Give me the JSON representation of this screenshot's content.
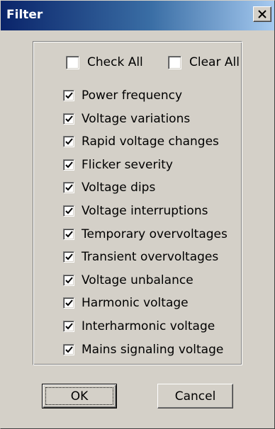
{
  "window": {
    "title": "Filter",
    "close_glyph": "close-x-icon"
  },
  "check_all": {
    "label": "Check All",
    "checked": false
  },
  "clear_all": {
    "label": "Clear All",
    "checked": false
  },
  "items": [
    {
      "label": "Power frequency",
      "checked": true
    },
    {
      "label": "Voltage variations",
      "checked": true
    },
    {
      "label": "Rapid voltage changes",
      "checked": true
    },
    {
      "label": "Flicker severity",
      "checked": true
    },
    {
      "label": "Voltage dips",
      "checked": true
    },
    {
      "label": "Voltage interruptions",
      "checked": true
    },
    {
      "label": "Temporary overvoltages",
      "checked": true
    },
    {
      "label": "Transient overvoltages",
      "checked": true
    },
    {
      "label": "Voltage unbalance",
      "checked": true
    },
    {
      "label": "Harmonic voltage",
      "checked": true
    },
    {
      "label": "Interharmonic voltage",
      "checked": true
    },
    {
      "label": "Mains signaling voltage",
      "checked": true
    }
  ],
  "buttons": {
    "ok_label": "OK",
    "cancel_label": "Cancel"
  },
  "colors": {
    "title_start": "#0a246a",
    "title_end": "#a6caf0",
    "face": "#d4d0c8"
  }
}
